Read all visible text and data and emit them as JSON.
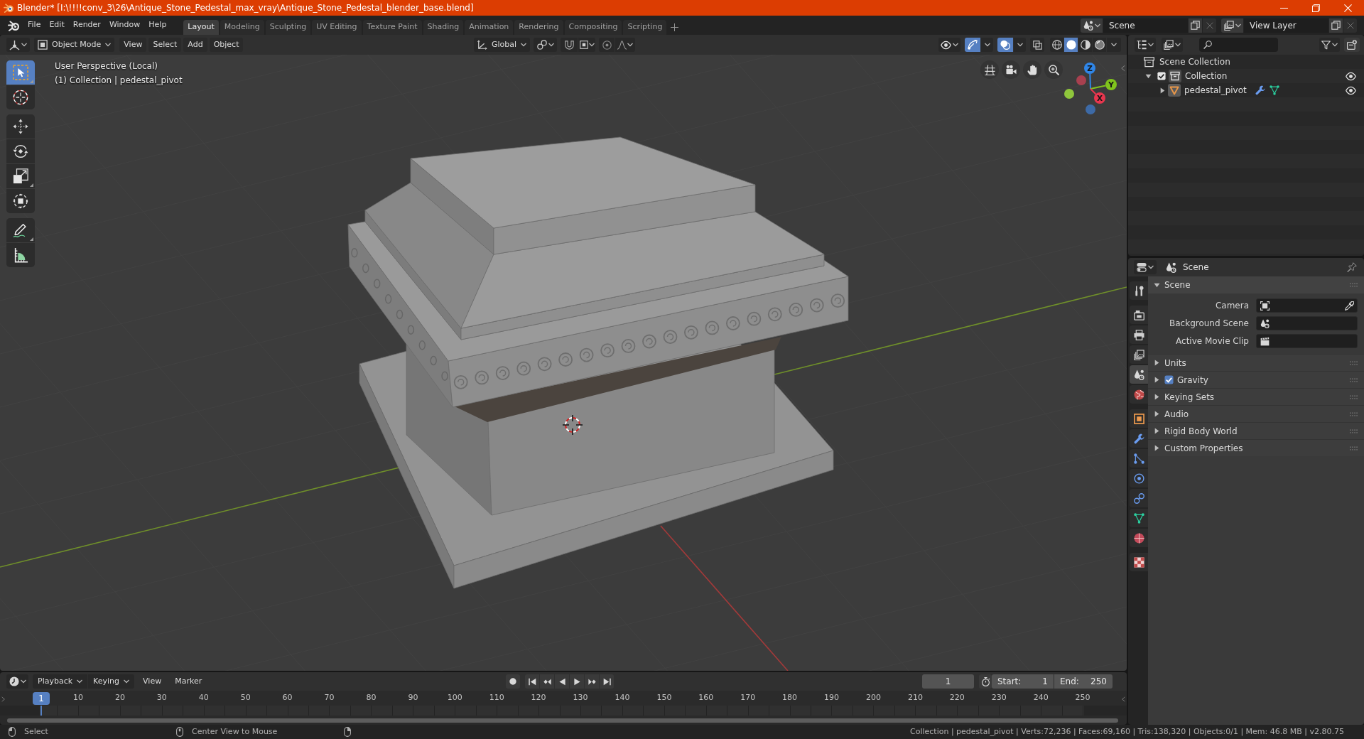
{
  "window": {
    "title": "Blender* [I:\\!!!!conv_3\\26\\Antique_Stone_Pedestal_max_vray\\Antique_Stone_Pedestal_blender_base.blend]"
  },
  "menu": [
    "File",
    "Edit",
    "Render",
    "Window",
    "Help"
  ],
  "workspaces": [
    {
      "label": "Layout",
      "selected": true
    },
    {
      "label": "Modeling",
      "selected": false
    },
    {
      "label": "Sculpting",
      "selected": false
    },
    {
      "label": "UV Editing",
      "selected": false
    },
    {
      "label": "Texture Paint",
      "selected": false
    },
    {
      "label": "Shading",
      "selected": false
    },
    {
      "label": "Animation",
      "selected": false
    },
    {
      "label": "Rendering",
      "selected": false
    },
    {
      "label": "Compositing",
      "selected": false
    },
    {
      "label": "Scripting",
      "selected": false
    }
  ],
  "scene": {
    "value": "Scene"
  },
  "view_layer": {
    "value": "View Layer"
  },
  "viewport": {
    "mode": "Object Mode",
    "menus": [
      "View",
      "Select",
      "Add",
      "Object"
    ],
    "orientation": "Global",
    "gizmos": {
      "on": true
    },
    "overlays": {
      "on": true
    },
    "xray": {
      "on": false
    },
    "shading": [
      {
        "selected": false
      },
      {
        "selected": true
      },
      {
        "selected": false
      },
      {
        "selected": false
      }
    ],
    "toolbar": [
      [
        {
          "selected": true,
          "more": true
        },
        {
          "selected": false,
          "more": false
        }
      ],
      [
        {
          "selected": false,
          "more": false
        },
        {
          "selected": false,
          "more": false
        },
        {
          "selected": false,
          "more": true
        },
        {
          "selected": false,
          "more": false
        }
      ],
      [
        {
          "selected": false,
          "more": true
        },
        {
          "selected": false,
          "more": false
        }
      ]
    ],
    "info": [
      "User Perspective (Local)",
      "(1) Collection | pedestal_pivot"
    ],
    "gizmo": {
      "axes": [
        {
          "label": "Z",
          "color": "#2f86e8"
        },
        {
          "label": "Y",
          "color": "#80c41d"
        },
        {
          "label": "X",
          "color": "#e8364e"
        }
      ],
      "negative_axes": [
        {
          "color": "#3d6aa6"
        },
        {
          "color": "#8fc63c"
        },
        {
          "color": "#a8404f"
        }
      ]
    }
  },
  "outliner": {
    "root": {
      "label": "Scene Collection",
      "children": [
        {
          "kind": "collection",
          "label": "Collection",
          "expanded": true,
          "checked": true,
          "visible": true,
          "children": [
            {
              "kind": "object",
              "label": "pedestal_pivot",
              "expanded": false,
              "visible": true
            }
          ]
        }
      ]
    }
  },
  "properties": {
    "context": "Scene",
    "tab_groups": [
      [
        {
          "selected": false
        }
      ],
      [
        {
          "selected": false
        },
        {
          "selected": false
        },
        {
          "selected": false
        },
        {
          "selected": true
        },
        {
          "selected": false
        }
      ],
      [
        {
          "selected": false
        },
        {
          "selected": false
        },
        {
          "selected": false
        },
        {
          "selected": false
        },
        {
          "selected": false
        },
        {
          "selected": false
        },
        {
          "selected": false
        }
      ],
      [
        {
          "selected": false
        }
      ]
    ],
    "panels": [
      {
        "kind": "plain",
        "label": "Scene",
        "expanded": true,
        "fields": [
          {
            "label": "Camera"
          },
          {
            "label": "Background Scene"
          },
          {
            "label": "Active Movie Clip"
          }
        ]
      },
      {
        "kind": "plain",
        "label": "Units",
        "expanded": false
      },
      {
        "kind": "toggle",
        "label": "Gravity",
        "expanded": false,
        "checked": true
      },
      {
        "kind": "plain",
        "label": "Keying Sets",
        "expanded": false
      },
      {
        "kind": "plain",
        "label": "Audio",
        "expanded": false
      },
      {
        "kind": "plain",
        "label": "Rigid Body World",
        "expanded": false
      },
      {
        "kind": "plain",
        "label": "Custom Properties",
        "expanded": false
      }
    ]
  },
  "timeline": {
    "menus": [
      {
        "label": "Playback",
        "dropdown": true
      },
      {
        "label": "Keying",
        "dropdown": true
      },
      {
        "label": "View",
        "dropdown": false
      },
      {
        "label": "Marker",
        "dropdown": false
      }
    ],
    "frame": "1",
    "start_label": "Start:",
    "start": "1",
    "end_label": "End:",
    "end": "250",
    "current": "1",
    "ticks": [
      "10",
      "20",
      "30",
      "40",
      "50",
      "60",
      "70",
      "80",
      "90",
      "100",
      "110",
      "120",
      "130",
      "140",
      "150",
      "160",
      "170",
      "180",
      "190",
      "200",
      "210",
      "220",
      "230",
      "240",
      "250"
    ]
  },
  "status_bar": {
    "hints": [
      "Select",
      "Center View to Mouse"
    ],
    "stats": "Collection | pedestal_pivot | Verts:72,236 | Faces:69,160 | Tris:138,320 | Objects:0/1 | Mem: 46.8 MB | v2.80.75"
  }
}
